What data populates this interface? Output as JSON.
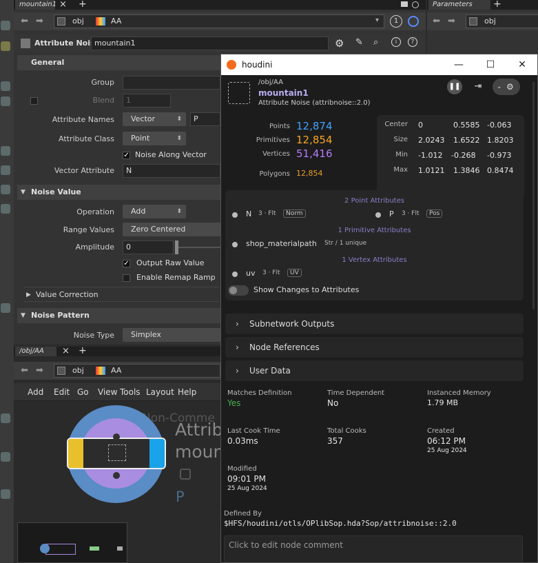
{
  "left_pane": {
    "tab_label": "mountain1",
    "path": {
      "root": "obj",
      "node": "AA"
    },
    "node_type_label": "Attribute Noise",
    "node_name": "mountain1",
    "sections": {
      "general": "General",
      "noise_value": "Noise Value",
      "value_correction": "Value Correction",
      "noise_pattern": "Noise Pattern"
    },
    "params": {
      "group_label": "Group",
      "blend_label": "Blend",
      "blend_value": "1",
      "attribute_names_label": "Attribute Names",
      "attribute_names_type": "Vector",
      "attribute_names_value": "P",
      "attribute_class_label": "Attribute Class",
      "attribute_class_value": "Point",
      "noise_along_vector": "Noise Along Vector",
      "vector_attribute_label": "Vector Attribute",
      "vector_attribute_value": "N",
      "operation_label": "Operation",
      "operation_value": "Add",
      "range_values_label": "Range Values",
      "range_values_value": "Zero Centered",
      "amplitude_label": "Amplitude",
      "amplitude_value": "0",
      "output_raw_value": "Output Raw Value",
      "enable_remap_ramp": "Enable Remap Ramp",
      "noise_type_label": "Noise Type",
      "noise_type_value": "Simplex"
    }
  },
  "right_pane": {
    "tab_label": "Parameters",
    "path_root": "obj"
  },
  "network_pane": {
    "tab_label": "/obj/AA",
    "path": {
      "root": "obj",
      "node": "AA"
    },
    "menu": [
      "Add",
      "Edit",
      "Go",
      "View",
      "Tools",
      "Layout",
      "Help"
    ],
    "watermark": "Non-Comme",
    "node_label_1": "Attrib",
    "node_label_2": "moun",
    "node_flag": "P"
  },
  "popup": {
    "window_title": "houdini",
    "node_path": "/obj/AA",
    "node_name": "mountain1",
    "node_type": "Attribute Noise (attribnoise::2.0)",
    "counts": {
      "points_label": "Points",
      "points": "12,874",
      "primitives_label": "Primitives",
      "primitives": "12,854",
      "vertices_label": "Vertices",
      "vertices": "51,416",
      "polygons_label": "Polygons",
      "polygons": "12,854"
    },
    "bounds": {
      "center_label": "Center",
      "center": [
        "0",
        "0.5585",
        "-0.063"
      ],
      "size_label": "Size",
      "size": [
        "2.0243",
        "1.6522",
        "1.8203"
      ],
      "min_label": "Min",
      "min": [
        "-1.012",
        "-0.268",
        "-0.973"
      ],
      "max_label": "Max",
      "max": [
        "1.0121",
        "1.3846",
        "0.8474"
      ]
    },
    "attributes": {
      "point_title": "2 Point Attributes",
      "n_name": "N",
      "n_type": "3 · Flt",
      "n_badge": "Norm",
      "p_name": "P",
      "p_type": "3 · Flt",
      "p_badge": "Pos",
      "prim_title": "1 Primitive Attributes",
      "shop_name": "shop_materialpath",
      "shop_type": "Str / 1 unique",
      "vertex_title": "1 Vertex Attributes",
      "uv_name": "uv",
      "uv_type": "3 · Flt",
      "uv_badge": "UV",
      "show_changes": "Show Changes to Attributes"
    },
    "collapsibles": [
      "Subnetwork Outputs",
      "Node References",
      "User Data"
    ],
    "info": {
      "matches_definition_label": "Matches Definition",
      "matches_definition": "Yes",
      "time_dependent_label": "Time Dependent",
      "time_dependent": "No",
      "instanced_memory_label": "Instanced Memory",
      "instanced_memory": "1.79 MB",
      "last_cook_label": "Last Cook Time",
      "last_cook": "0.03ms",
      "total_cooks_label": "Total Cooks",
      "total_cooks": "357",
      "created_label": "Created",
      "created_time": "06:12 PM",
      "created_date": "25 Aug 2024",
      "modified_label": "Modified",
      "modified_time": "09:01 PM",
      "modified_date": "25 Aug 2024"
    },
    "defined_by_label": "Defined By",
    "defined_by": "$HFS/houdini/otls/OPlibSop.hda?Sop/attribnoise::2.0",
    "comment_placeholder": "Click to edit node comment"
  },
  "colors": {
    "points": "#3fa3ff",
    "primitives": "#f5a623",
    "vertices": "#b57bff",
    "polygons": "#e8a030",
    "yes": "#4caf50",
    "accent": "#8b7ec9"
  }
}
